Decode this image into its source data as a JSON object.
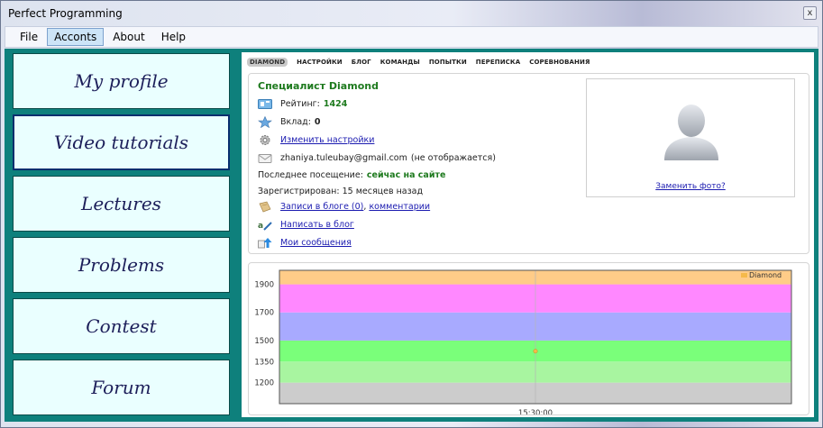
{
  "window": {
    "title": "Perfect Programming",
    "close_glyph": "x"
  },
  "menu": [
    "File",
    "Acconts",
    "About",
    "Help"
  ],
  "nav": [
    {
      "label": "My profile",
      "selected": false
    },
    {
      "label": "Video tutorials",
      "selected": true
    },
    {
      "label": "Lectures",
      "selected": false
    },
    {
      "label": "Problems",
      "selected": false
    },
    {
      "label": "Contest",
      "selected": false
    },
    {
      "label": "Forum",
      "selected": false
    }
  ],
  "tabs": [
    "DIAMOND",
    "НАСТРОЙКИ",
    "БЛОГ",
    "КОМАНДЫ",
    "ПОПЫТКИ",
    "ПЕРЕПИСКА",
    "СОРЕВНОВАНИЯ"
  ],
  "profile": {
    "name": "Специалист Diamond",
    "rating_label": "Рейтинг:",
    "rating_value": "1424",
    "contribution_label": "Вклад:",
    "contribution_value": "0",
    "settings_link": "Изменить настройки",
    "email": "zhaniya.tuleubay@gmail.com",
    "email_note": "(не отображается)",
    "last_visit_label": "Последнее посещение:",
    "last_visit_value": "сейчас на сайте",
    "registered": "Зарегистрирован: 15 месяцев назад",
    "blog_entries_link": "Записи в блоге (0)",
    "comments_link": "комментарии",
    "write_blog_link": "Написать в блог",
    "messages_link": "Мои сообщения",
    "change_photo": "Заменить фото?"
  },
  "icons": {
    "rating": "rating-icon",
    "contribution": "star-icon",
    "settings": "gear-icon",
    "email": "envelope-icon",
    "blog": "blog-icon",
    "write": "pen-icon",
    "messages": "arrow-up-icon",
    "avatar": "avatar-placeholder-icon"
  },
  "chart_data": {
    "type": "line",
    "yticks": [
      1200,
      1350,
      1500,
      1700,
      1900
    ],
    "ylim": [
      1050,
      2000
    ],
    "x_tick_label": "15:30:00",
    "bands": [
      {
        "from": 1050,
        "to": 1200,
        "color": "#cccccc"
      },
      {
        "from": 1200,
        "to": 1350,
        "color": "#a8f5a0"
      },
      {
        "from": 1350,
        "to": 1500,
        "color": "#7aff7a"
      },
      {
        "from": 1500,
        "to": 1700,
        "color": "#a8aaff"
      },
      {
        "from": 1700,
        "to": 1900,
        "color": "#ff88ff"
      },
      {
        "from": 1900,
        "to": 2000,
        "color": "#ffcc88"
      }
    ],
    "series": [
      {
        "name": "Diamond",
        "color": "#f5b94a",
        "points": [
          {
            "x": "15:30:00",
            "y": 1424
          }
        ]
      }
    ]
  }
}
